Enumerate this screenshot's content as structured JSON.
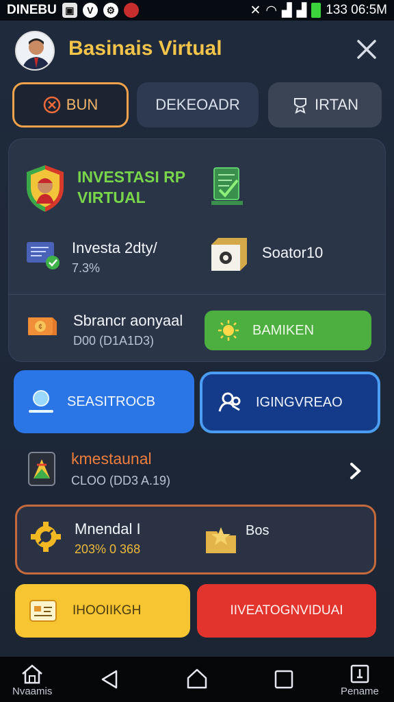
{
  "status_bar": {
    "carrier": "DINEBU",
    "time": "133 06:5M"
  },
  "header": {
    "title": "Basinais Virtual"
  },
  "tabs": [
    {
      "label": "BUN"
    },
    {
      "label": "DEKEOADR"
    },
    {
      "label": "IRTAN"
    }
  ],
  "panel": {
    "invest_title_line1": "INVESTASI RP",
    "invest_title_line2": "VIRTUAL",
    "item_a": {
      "title": "Investa 2dty/",
      "value": "7.3%"
    },
    "item_b": {
      "title": "Soator10"
    },
    "item_c": {
      "title": "Sbrancr aonyaal",
      "value": "D00 (D1A1D3)"
    },
    "green_button": "BAMIKEN"
  },
  "actions": {
    "blue_left": "SEASITROCB",
    "blue_right": "IGINGVREAO"
  },
  "list_row": {
    "title": "kmestaunal",
    "value": "CLOO (DD3 A.19)"
  },
  "card": {
    "left_title": "Mnendal I",
    "left_value": "203% 0 368",
    "right_title": "Bos"
  },
  "bottom_buttons": {
    "yellow": "IHOOIIKGH",
    "red": "IIVEATOGNVIDUAI"
  },
  "navbar": {
    "home_label": "Nvaamis",
    "profile_label": "Pename"
  }
}
